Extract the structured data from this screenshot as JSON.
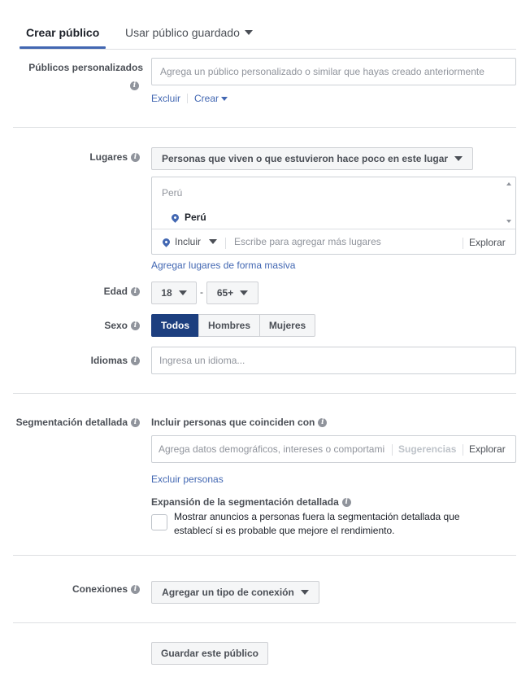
{
  "tabs": {
    "create": "Crear público",
    "saved": "Usar público guardado"
  },
  "custom_audiences": {
    "label": "Públicos personalizados",
    "placeholder": "Agrega un público personalizado o similar que hayas creado anteriormente",
    "exclude": "Excluir",
    "create": "Crear"
  },
  "locations": {
    "label": "Lugares",
    "dropdown": "Personas que viven o que estuvieron hace poco en este lugar",
    "group_title": "Perú",
    "selected": "Perú",
    "include": "Incluir",
    "search_placeholder": "Escribe para agregar más lugares",
    "explore": "Explorar",
    "bulk": "Agregar lugares de forma masiva"
  },
  "age": {
    "label": "Edad",
    "min": "18",
    "separator": "-",
    "max": "65+"
  },
  "gender": {
    "label": "Sexo",
    "all": "Todos",
    "men": "Hombres",
    "women": "Mujeres"
  },
  "languages": {
    "label": "Idiomas",
    "placeholder": "Ingresa un idioma..."
  },
  "detailed": {
    "label": "Segmentación detallada",
    "include_title": "Incluir personas que coinciden con",
    "placeholder": "Agrega datos demográficos, intereses o comportami",
    "suggestions": "Sugerencias",
    "explore": "Explorar",
    "exclude": "Excluir personas",
    "expansion_title": "Expansión de la segmentación detallada",
    "expansion_text_1": "Mostrar anuncios a personas fuera la segmentación detallada que",
    "expansion_text_2": "establecí si es probable que mejore el rendimiento."
  },
  "connections": {
    "label": "Conexiones",
    "dropdown": "Agregar un tipo de conexión"
  },
  "save_button": "Guardar este público",
  "colors": {
    "accent": "#4267b2",
    "active_segment": "#1d3f7f",
    "border": "#dddfe2"
  }
}
